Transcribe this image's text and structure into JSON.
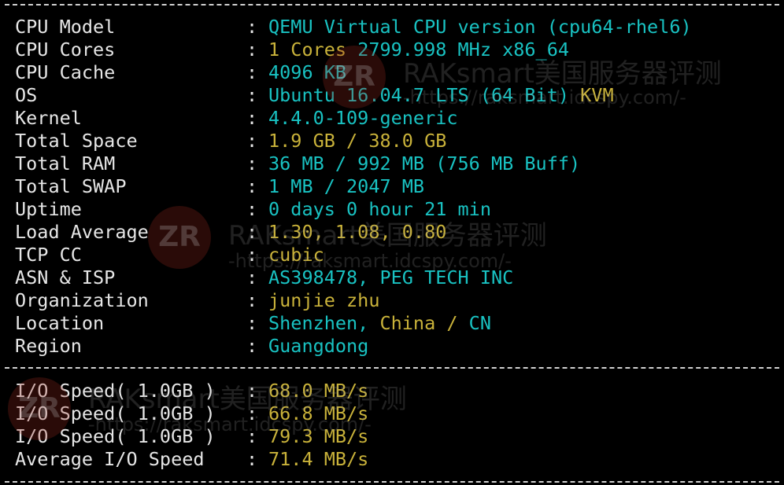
{
  "info_rows": [
    {
      "label": "CPU Model",
      "value_parts": [
        {
          "text": "QEMU Virtual CPU version (cpu64-rhel6)",
          "color": "cyan"
        }
      ]
    },
    {
      "label": "CPU Cores",
      "value_parts": [
        {
          "text": "1 Cores ",
          "color": "yellow"
        },
        {
          "text": "2799.998 MHz x86_64",
          "color": "cyan"
        }
      ]
    },
    {
      "label": "CPU Cache",
      "value_parts": [
        {
          "text": "4096 KB",
          "color": "cyan"
        }
      ]
    },
    {
      "label": "OS",
      "value_parts": [
        {
          "text": "Ubuntu 16.04.7 LTS (64 Bit) ",
          "color": "cyan"
        },
        {
          "text": "KVM",
          "color": "yellow"
        }
      ]
    },
    {
      "label": "Kernel",
      "value_parts": [
        {
          "text": "4.4.0-109-generic",
          "color": "cyan"
        }
      ]
    },
    {
      "label": "Total Space",
      "value_parts": [
        {
          "text": "1.9 GB / 38.0 GB",
          "color": "yellow"
        }
      ]
    },
    {
      "label": "Total RAM",
      "value_parts": [
        {
          "text": "36 MB / 992 MB (756 MB Buff)",
          "color": "cyan"
        }
      ]
    },
    {
      "label": "Total SWAP",
      "value_parts": [
        {
          "text": "1 MB / 2047 MB",
          "color": "cyan"
        }
      ]
    },
    {
      "label": "Uptime",
      "value_parts": [
        {
          "text": "0 days 0 hour 21 min",
          "color": "cyan"
        }
      ]
    },
    {
      "label": "Load Average",
      "value_parts": [
        {
          "text": "1.30, 1.08, 0.80",
          "color": "yellow"
        }
      ]
    },
    {
      "label": "TCP CC",
      "value_parts": [
        {
          "text": "cubic",
          "color": "yellow"
        }
      ]
    },
    {
      "label": "ASN & ISP",
      "value_parts": [
        {
          "text": "AS398478, PEG TECH INC",
          "color": "cyan"
        }
      ]
    },
    {
      "label": "Organization",
      "value_parts": [
        {
          "text": "junjie zhu",
          "color": "yellow"
        }
      ]
    },
    {
      "label": "Location",
      "value_parts": [
        {
          "text": "Shenzhen, ",
          "color": "cyan"
        },
        {
          "text": "China / ",
          "color": "yellow"
        },
        {
          "text": "CN",
          "color": "cyan"
        }
      ]
    },
    {
      "label": "Region",
      "value_parts": [
        {
          "text": "Guangdong",
          "color": "cyan"
        }
      ]
    }
  ],
  "io_rows": [
    {
      "label": "I/O Speed( 1.0GB )",
      "value": "68.0 MB/s"
    },
    {
      "label": "I/O Speed( 1.0GB )",
      "value": "66.8 MB/s"
    },
    {
      "label": "I/O Speed( 1.0GB )",
      "value": "79.3 MB/s"
    },
    {
      "label": "Average I/O Speed",
      "value": "71.4 MB/s"
    }
  ],
  "colon": ":",
  "watermark": {
    "logo_text": "ZR",
    "title": "RAKsmart美国服务器评测",
    "url": "-https://raksmart.idcspy.com/-"
  },
  "colors": {
    "background": "#000000",
    "label": "#e6e6e6",
    "cyan": "#19c2c2",
    "yellow": "#c9b23a"
  }
}
